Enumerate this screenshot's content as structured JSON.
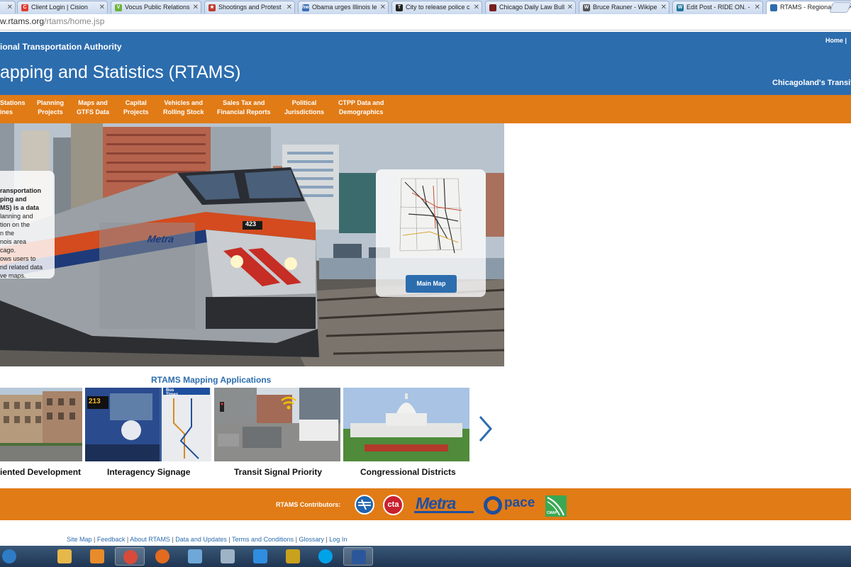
{
  "browser": {
    "tabs": [
      {
        "title": "Client Login | Cision",
        "icon": "cision-icon",
        "color": "#e23b2e",
        "letter": "C"
      },
      {
        "title": "Vocus Public Relations",
        "icon": "vocus-icon",
        "color": "#6bb33a",
        "letter": "V"
      },
      {
        "title": "Shootings and Protest",
        "icon": "news-icon",
        "color": "#c0392b",
        "letter": "★"
      },
      {
        "title": "Obama urges Illinois le",
        "icon": "hw-icon",
        "color": "#3a6fb5",
        "letter": "hw"
      },
      {
        "title": "City to release police c",
        "icon": "tribune-icon",
        "color": "#222222",
        "letter": "T"
      },
      {
        "title": "Chicago Daily Law Bull",
        "icon": "law-bulletin-icon",
        "color": "#7a1e1e",
        "letter": ""
      },
      {
        "title": "Bruce Rauner - Wikipe",
        "icon": "wikipedia-icon",
        "color": "#555555",
        "letter": "W"
      },
      {
        "title": "Edit Post - RIDE ON. -",
        "icon": "wordpress-icon",
        "color": "#21759b",
        "letter": "W"
      },
      {
        "title": "RTAMS - Regional Tra",
        "icon": "rtams-icon",
        "color": "#2c6dae",
        "letter": "",
        "active": true
      }
    ],
    "url_visible": "w.rtams.org",
    "url_path": "/rtams/home.jsp"
  },
  "header": {
    "org": "ional Transportation Authority",
    "title": "apping and Statistics (RTAMS)",
    "links": "Home |",
    "tagline": "Chicagoland's Transit"
  },
  "nav": [
    {
      "line1": "Stations",
      "line2": "ines"
    },
    {
      "line1": "Planning",
      "line2": "Projects"
    },
    {
      "line1": "Maps and",
      "line2": "GTFS Data"
    },
    {
      "line1": "Capital",
      "line2": "Projects"
    },
    {
      "line1": "Vehicles and",
      "line2": "Rolling Stock"
    },
    {
      "line1": "Sales Tax and",
      "line2": "Financial Reports"
    },
    {
      "line1": "Political",
      "line2": "Jurisdictions"
    },
    {
      "line1": "CTPP Data and",
      "line2": "Demographics"
    }
  ],
  "hero": {
    "intro_lines": [
      "ransportation",
      "ping and",
      "MS) is a data",
      "lanning and",
      "tion on the",
      "n the",
      "nois area",
      "cago.",
      "ows users to",
      "nd related data",
      "ve maps."
    ],
    "intro_bold_count": 3,
    "train_number": "423",
    "train_logo": "Metra",
    "map_button": "Main Map"
  },
  "apps": {
    "title": "RTAMS Mapping Applications",
    "items": [
      {
        "caption": "iented Development",
        "name": "tod-app"
      },
      {
        "caption": "Interagency Signage",
        "name": "signage-app",
        "bus_number": "213",
        "sign_title": "Bus Times"
      },
      {
        "caption": "Transit Signal Priority",
        "name": "tsp-app"
      },
      {
        "caption": "Congressional Districts",
        "name": "districts-app"
      }
    ]
  },
  "contributors": {
    "label": "RTAMS Contributors:",
    "logos": [
      {
        "name": "rta-logo",
        "text": "RTA"
      },
      {
        "name": "cta-logo",
        "text": "cta"
      },
      {
        "name": "metra-logo",
        "text": "Metra"
      },
      {
        "name": "pace-logo",
        "text": "pace"
      },
      {
        "name": "cmap-logo",
        "text": "CMAP"
      }
    ]
  },
  "footer": {
    "links": [
      "Site Map",
      "Feedback",
      "About RTAMS",
      "Data and Updates",
      "Terms and Conditions",
      "Glossary",
      "Log In"
    ]
  },
  "taskbar": {
    "items": [
      {
        "name": "start-button",
        "icon": "start-icon"
      },
      {
        "name": "explorer-taskbar-button",
        "icon": "folder-icon"
      },
      {
        "name": "outlook-taskbar-button",
        "icon": "outlook-icon"
      },
      {
        "name": "chrome-taskbar-button",
        "icon": "chrome-icon",
        "active": true
      },
      {
        "name": "firefox-taskbar-button",
        "icon": "firefox-icon"
      },
      {
        "name": "notepad-taskbar-button",
        "icon": "notepad-icon"
      },
      {
        "name": "calculator-taskbar-button",
        "icon": "calculator-icon"
      },
      {
        "name": "ie-taskbar-button",
        "icon": "internet-explorer-icon"
      },
      {
        "name": "app-taskbar-button",
        "icon": "chart-app-icon"
      },
      {
        "name": "skype-taskbar-button",
        "icon": "skype-icon"
      },
      {
        "name": "word-taskbar-button",
        "icon": "word-icon",
        "active": true
      }
    ]
  }
}
